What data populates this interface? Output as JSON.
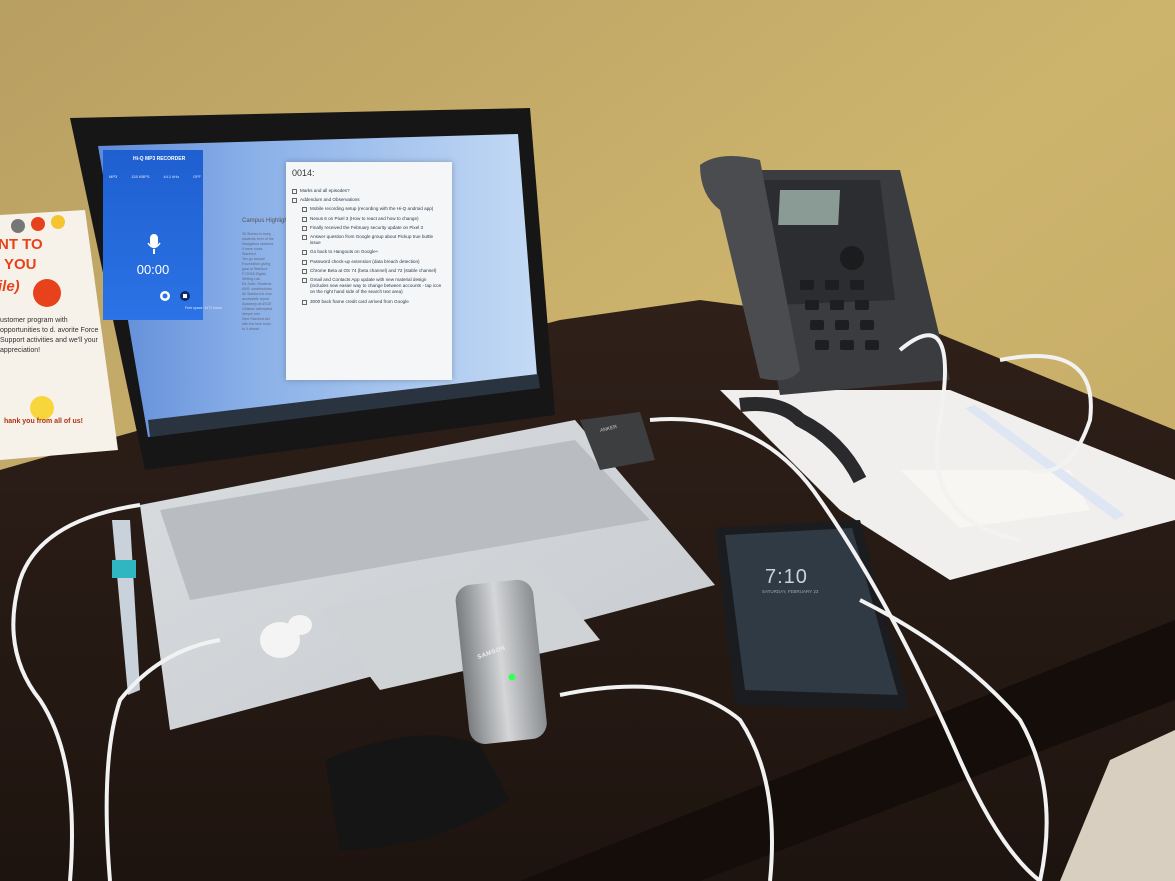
{
  "scene": {
    "description_objects": [
      "laptop",
      "desk-phone",
      "smartphone",
      "usb-microphone",
      "usb-hub",
      "pen",
      "earbuds",
      "notepad",
      "table-sign"
    ]
  },
  "laptop_screen": {
    "recorder": {
      "title": "Hi-Q MP3 RECORDER",
      "stats": [
        "MP3",
        "128 KBPS",
        "44.1 kHz",
        "OFF"
      ],
      "time": "00:00",
      "free_space": "Free space: 1471 hours"
    },
    "keep_panel": {
      "title": "Campus Highlights",
      "items": [
        "25 Stories to keep",
        "students form of the",
        "Navigators stanford",
        "9 were cross",
        "Stanford",
        "Ten go annual",
        "Foundation giving",
        "goal at Stanford",
        "FY2026 Digital",
        "Writing Lab",
        "Ed Jobb: Students",
        "ANS: contributions",
        "All Stanford is now",
        "accessible report",
        "Academy at ASCE",
        "Ghisleni attempted",
        "deeper into",
        "New Stanford aid",
        "with the tech tools",
        "to 4 ahead"
      ]
    },
    "note": {
      "title": "0014:",
      "items": [
        {
          "text": "Marks and all episodes?",
          "sub": false
        },
        {
          "text": "Addendum and Observations",
          "sub": false
        },
        {
          "text": "Mobile recording setup (recording with the Hi-Q android app)",
          "sub": true
        },
        {
          "text": "Nexus 6 on Pixel 3 (How to react and how to change)",
          "sub": true
        },
        {
          "text": "Finally received the February security update on Pixel 3",
          "sub": true
        },
        {
          "text": "Answer question from Google group about Pickup true buttle issue",
          "sub": true
        },
        {
          "text": "Go back to Hangouts on Google+",
          "sub": true
        },
        {
          "text": "Password check-up extension (data breach detection)",
          "sub": true
        },
        {
          "text": "Chrome Beta at OS 74 (beta channel) and 72 (stable channel)",
          "sub": true
        },
        {
          "text": "Gmail and Contacts App update with new material design (includes new easier way to change between accounts - tap icon on the right hand side of the search text area)",
          "sub": true
        },
        {
          "text": "3000 back frame credit card arrived from Google",
          "sub": true
        }
      ]
    }
  },
  "phone_screen": {
    "time": "7:10",
    "date": "SATURDAY, FEBRUARY 23"
  },
  "microphone": {
    "brand": "SAMSON"
  },
  "usb_hub": {
    "brand": "ANKER"
  },
  "sign": {
    "line1": "NT TO",
    "line2": "YOU",
    "line3": "ile)",
    "body": "ustomer program with opportunities to d. avorite Force Support activities and we'll your appreciation!",
    "footer": "hank you from all of us!"
  },
  "colors": {
    "wall": "#c9ae68",
    "desk": "#2a1c14",
    "screen_blue": "#2b73e6",
    "sign_accent": "#e8421c"
  }
}
